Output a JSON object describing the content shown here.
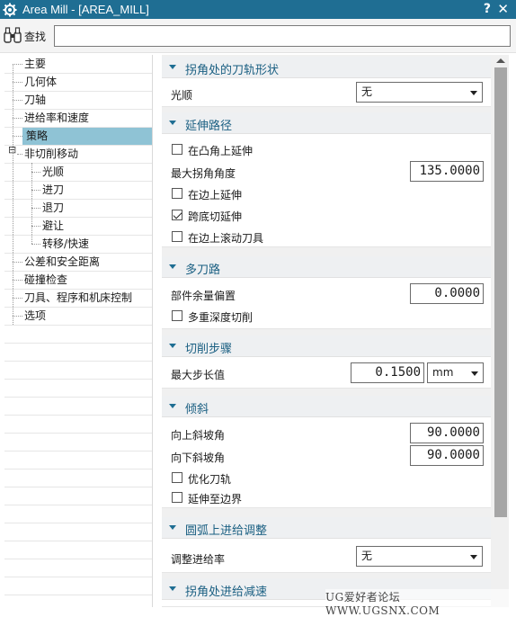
{
  "window": {
    "title": "Area Mill - [AREA_MILL]",
    "help": "?",
    "close": "✕"
  },
  "search": {
    "label": "查找",
    "value": ""
  },
  "tree": {
    "items": [
      {
        "label": "主要"
      },
      {
        "label": "几何体"
      },
      {
        "label": "刀轴"
      },
      {
        "label": "进给率和速度"
      },
      {
        "label": "策略",
        "selected": true
      },
      {
        "label": "非切削移动",
        "expander": "⊟"
      },
      {
        "label": "光顺"
      },
      {
        "label": "进刀"
      },
      {
        "label": "退刀"
      },
      {
        "label": "避让"
      },
      {
        "label": "转移/快速"
      },
      {
        "label": "公差和安全距离"
      },
      {
        "label": "碰撞检查"
      },
      {
        "label": "刀具、程序和机床控制"
      },
      {
        "label": "选项"
      }
    ]
  },
  "sections": {
    "corner_shape": {
      "title": "拐角处的刀轨形状",
      "smooth_label": "光顺",
      "smooth_value": "无"
    },
    "extend_path": {
      "title": "延伸路径",
      "extend_convex_label": "在凸角上延伸",
      "extend_convex_checked": false,
      "max_corner_angle_label": "最大拐角角度",
      "max_corner_angle_value": "135.0000",
      "extend_edge_label": "在边上延伸",
      "extend_edge_checked": false,
      "cross_bottom_label": "跨底切延伸",
      "cross_bottom_checked": true,
      "roll_tool_label": "在边上滚动刀具",
      "roll_tool_checked": false
    },
    "multi_pass": {
      "title": "多刀路",
      "part_stock_offset_label": "部件余量偏置",
      "part_stock_offset_value": "0.0000",
      "multi_depth_label": "多重深度切削",
      "multi_depth_checked": false
    },
    "cut_step": {
      "title": "切削步骤",
      "max_step_label": "最大步长值",
      "max_step_value": "0.1500",
      "unit": "mm"
    },
    "tilt": {
      "title": "倾斜",
      "ramp_up_label": "向上斜坡角",
      "ramp_up_value": "90.0000",
      "ramp_down_label": "向下斜坡角",
      "ramp_down_value": "90.0000",
      "optimize_label": "优化刀轨",
      "optimize_checked": false,
      "extend_boundary_label": "延伸至边界",
      "extend_boundary_checked": false
    },
    "arc_feed": {
      "title": "圆弧上进给调整",
      "adjust_label": "调整进给率",
      "adjust_value": "无"
    },
    "corner_feed": {
      "title": "拐角处进给减速"
    }
  },
  "watermark": "UG爱好者论坛 WWW.UGSNX.COM",
  "colors": {
    "titlebar": "#1f6e93",
    "section_title": "#1a5f82",
    "selection": "#8fc3d5"
  }
}
